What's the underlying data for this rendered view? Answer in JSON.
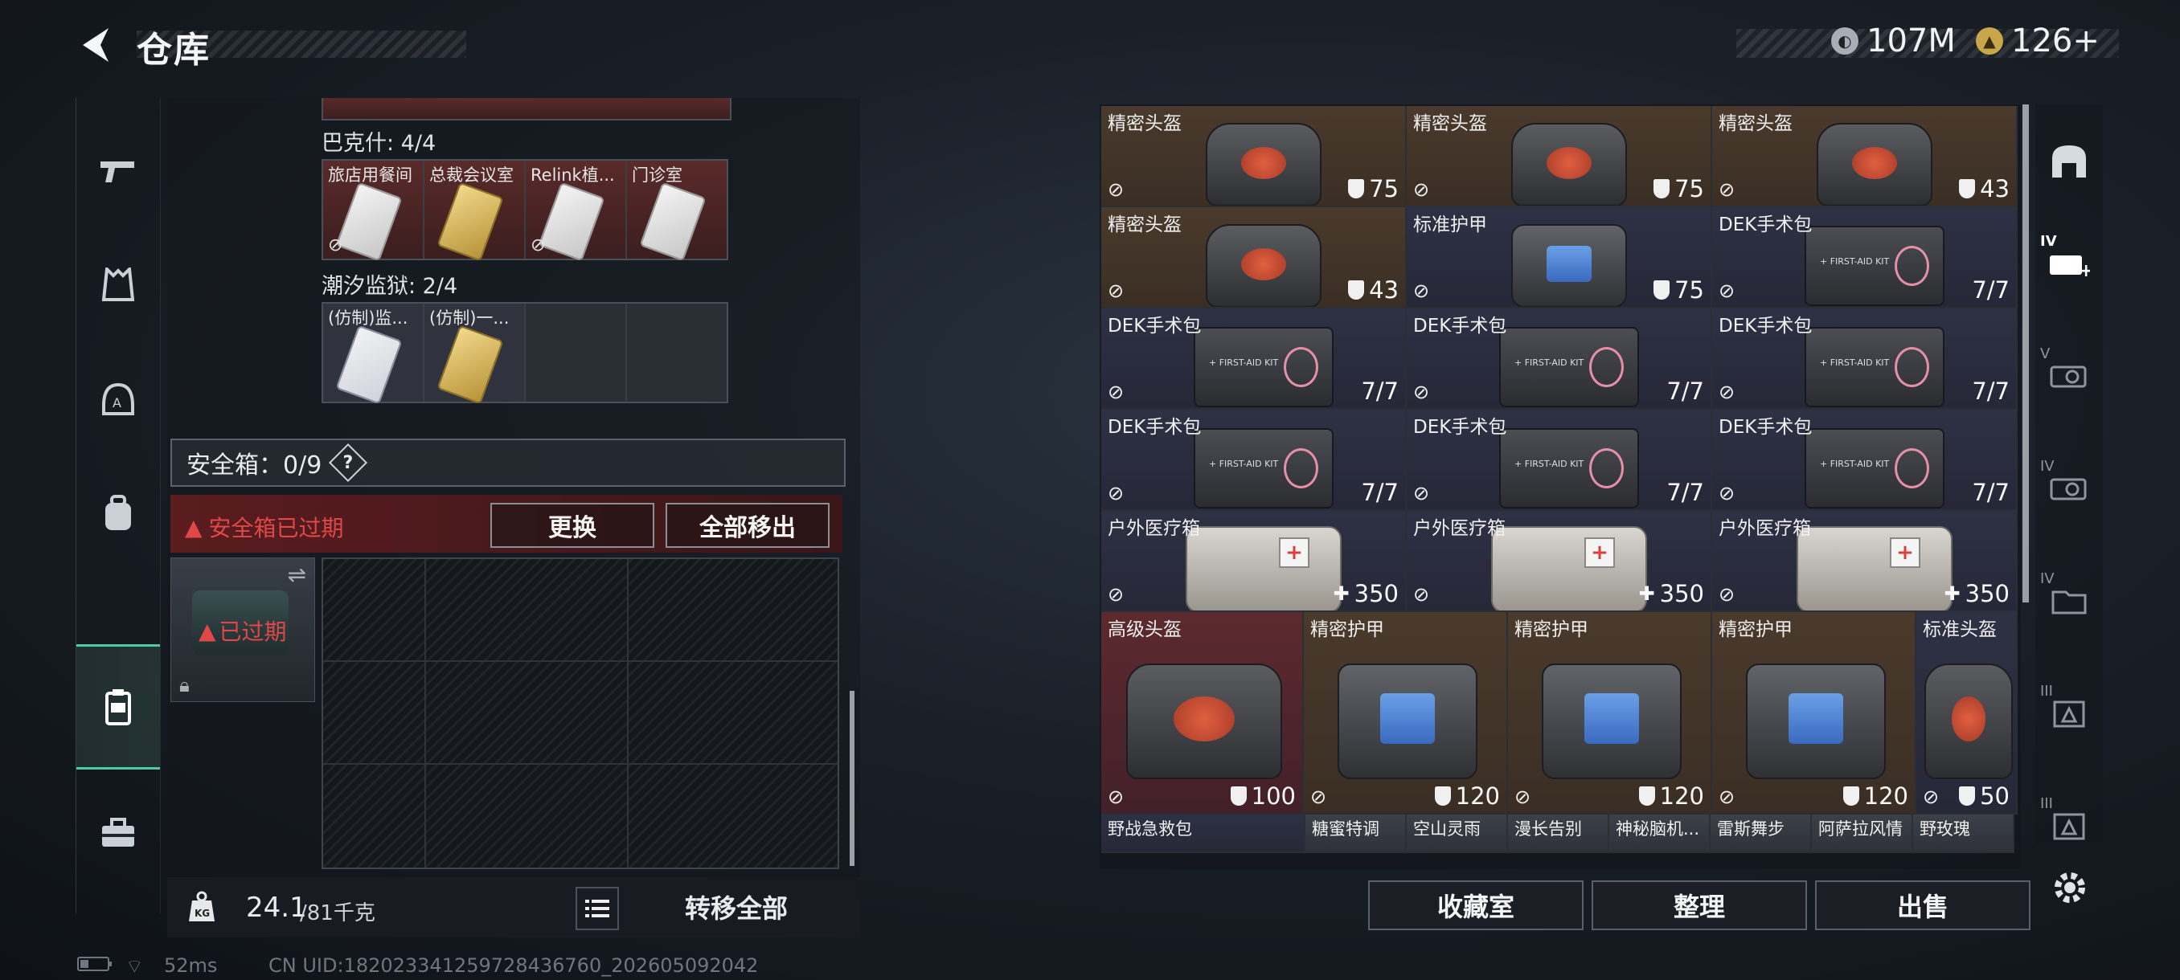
{
  "header": {
    "title": "仓库",
    "currency_silver": "107M",
    "currency_gold": "126+"
  },
  "left_rail": {
    "items": [
      {
        "icon": "gun-icon"
      },
      {
        "icon": "armor-vest-icon"
      },
      {
        "icon": "helmet-icon"
      },
      {
        "icon": "backpack-icon"
      },
      {
        "icon": "safe-box-icon",
        "active": true
      },
      {
        "icon": "toolbox-icon"
      }
    ]
  },
  "keys": {
    "baku_label": "巴克什: 4/4",
    "baku_cards": [
      "旅店用餐间",
      "总裁会议室",
      "Relink植...",
      "门诊室"
    ],
    "tide_label": "潮汐监狱: 2/4",
    "tide_cards": [
      "(仿制)监...",
      "(仿制)一..."
    ]
  },
  "safe_box": {
    "label": "安全箱：0/9",
    "help": "?",
    "expired_notice": "安全箱已过期",
    "replace_button": "更换",
    "remove_all_button": "全部移出",
    "expired_tag": "已过期"
  },
  "footer_left": {
    "weight_current": "24.1",
    "weight_max": "/81千克",
    "kg_badge": "KG",
    "transfer_all": "转移全部"
  },
  "inventory": {
    "rows": [
      [
        {
          "name": "精密头盔",
          "value": "75",
          "kind": "helmet",
          "bg": "brown",
          "stat": "shield"
        },
        {
          "name": "精密头盔",
          "value": "75",
          "kind": "helmet",
          "bg": "brown",
          "stat": "shield"
        },
        {
          "name": "精密头盔",
          "value": "43",
          "kind": "helmet",
          "bg": "brown",
          "stat": "shield"
        }
      ],
      [
        {
          "name": "精密头盔",
          "value": "43",
          "kind": "helmet",
          "bg": "brown",
          "stat": "shield"
        },
        {
          "name": "标准护甲",
          "value": "75",
          "kind": "armor",
          "bg": "navy",
          "stat": "shield"
        },
        {
          "name": "DEK手术包",
          "value": "7/7",
          "kind": "medkit",
          "bg": "navy",
          "stat": ""
        }
      ],
      [
        {
          "name": "DEK手术包",
          "value": "7/7",
          "kind": "medkit",
          "bg": "navy",
          "stat": ""
        },
        {
          "name": "DEK手术包",
          "value": "7/7",
          "kind": "medkit",
          "bg": "navy",
          "stat": ""
        },
        {
          "name": "DEK手术包",
          "value": "7/7",
          "kind": "medkit",
          "bg": "navy",
          "stat": ""
        }
      ],
      [
        {
          "name": "DEK手术包",
          "value": "7/7",
          "kind": "medkit",
          "bg": "navy",
          "stat": ""
        },
        {
          "name": "DEK手术包",
          "value": "7/7",
          "kind": "medkit",
          "bg": "navy",
          "stat": ""
        },
        {
          "name": "DEK手术包",
          "value": "7/7",
          "kind": "medkit",
          "bg": "navy",
          "stat": ""
        }
      ],
      [
        {
          "name": "户外医疗箱",
          "value": "350",
          "kind": "outdoor",
          "bg": "navy",
          "stat": "plus"
        },
        {
          "name": "户外医疗箱",
          "value": "350",
          "kind": "outdoor",
          "bg": "navy",
          "stat": "plus"
        },
        {
          "name": "户外医疗箱",
          "value": "350",
          "kind": "outdoor",
          "bg": "navy",
          "stat": "plus"
        }
      ]
    ],
    "large_row": [
      {
        "name": "高级头盔",
        "value": "100",
        "kind": "helmet",
        "bg": "red"
      },
      {
        "name": "精密护甲",
        "value": "120",
        "kind": "armor",
        "bg": "brown"
      },
      {
        "name": "精密护甲",
        "value": "120",
        "kind": "armor",
        "bg": "brown"
      },
      {
        "name": "精密护甲",
        "value": "120",
        "kind": "armor",
        "bg": "brown"
      },
      {
        "name": "标准头盔",
        "value": "50",
        "kind": "helmet",
        "bg": "navy"
      }
    ],
    "partial_row": [
      "野战急救包",
      "糖蜜特调",
      "空山灵雨",
      "漫长告别",
      "神秘脑机...",
      "雷斯舞步",
      "阿萨拉风情",
      "野玫瑰"
    ]
  },
  "actions": {
    "collection": "收藏室",
    "organize": "整理",
    "sell": "出售"
  },
  "right_rail": {
    "labels": [
      "IV",
      "V",
      "IV",
      "IV",
      "III",
      "III"
    ]
  },
  "status_bar": {
    "ping": "52ms",
    "uid": "CN UID:182023341259728436760_202605092042"
  },
  "colors": {
    "expired_red": "#e04848",
    "active_green": "#4ecba0",
    "gold_coin": "#c9a64a",
    "silver_coin": "#a8aeb4"
  }
}
